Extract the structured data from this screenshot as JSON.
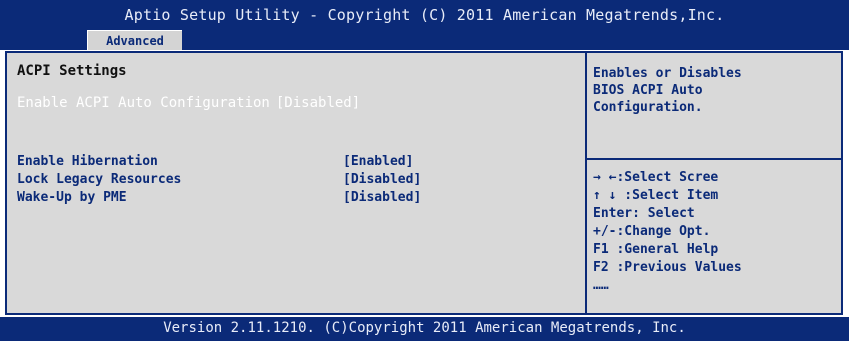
{
  "header": {
    "title": "Aptio Setup Utility - Copyright (C) 2011 American Megatrends,Inc.",
    "active_tab": "Advanced"
  },
  "main": {
    "section_title": "ACPI Settings",
    "greyed_option": {
      "label": "Enable ACPI Auto Configuration",
      "value": "[Disabled]"
    },
    "options": [
      {
        "label": "Enable Hibernation",
        "value": "[Enabled]"
      },
      {
        "label": "Lock Legacy Resources",
        "value": "[Disabled]"
      },
      {
        "label": "Wake-Up by PME",
        "value": "[Disabled]"
      }
    ]
  },
  "help": {
    "lines": [
      "Enables or Disables",
      "BIOS ACPI Auto",
      "Configuration."
    ]
  },
  "keys": [
    "→ ←:Select Scree",
    "↑ ↓ :Select Item",
    "Enter: Select",
    "+/-:Change Opt.",
    "F1 :General Help",
    "F2 :Previous Values",
    "……"
  ],
  "footer": {
    "text": "Version 2.11.1210. (C)Copyright 2011 American Megatrends, Inc."
  },
  "colors": {
    "bios_blue": "#0b2a78",
    "panel_grey": "#d9d9d9",
    "text_white": "#ffffff"
  }
}
